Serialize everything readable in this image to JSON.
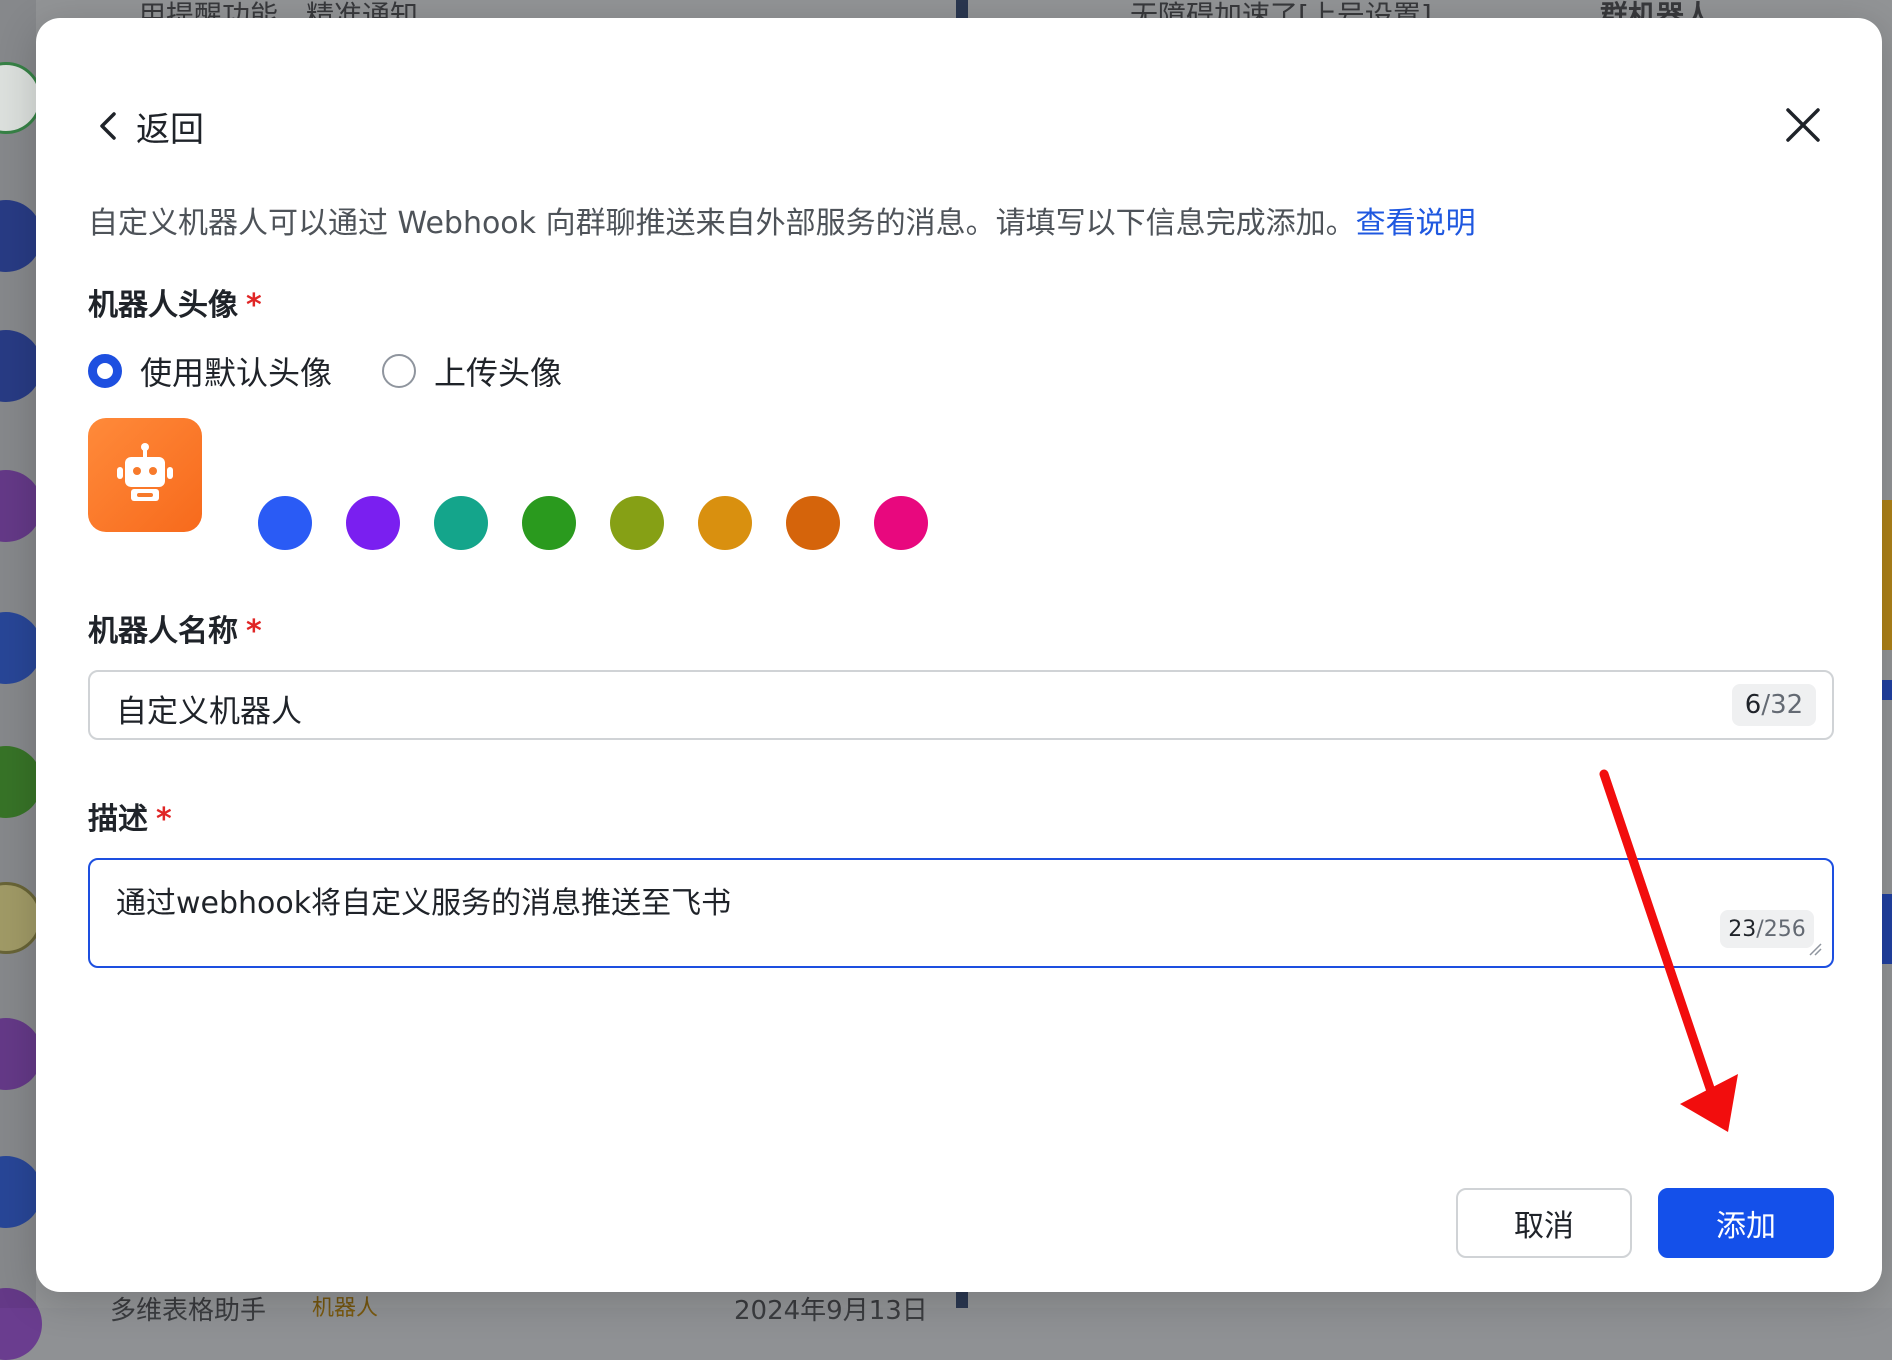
{
  "background": {
    "top_left_text": "…用提醒功能，精准通知…",
    "top_mid_text": "无障碍加速了[上号设置]",
    "top_right_text": "群机器人",
    "bottom_left_text": "多维表格助手",
    "bottom_badge": "机器人",
    "bottom_date": "2024年9月13日"
  },
  "modal": {
    "back_label": "返回",
    "intro_text": "自定义机器人可以通过 Webhook 向群聊推送来自外部服务的消息。请填写以下信息完成添加。",
    "intro_link": "查看说明",
    "avatar_section": {
      "label": "机器人头像",
      "required_mark": "*",
      "options": [
        {
          "label": "使用默认头像",
          "checked": true
        },
        {
          "label": "上传头像",
          "checked": false
        }
      ],
      "preview_color": "#f77a2b",
      "swatches": [
        "#2a5bf5",
        "#7a1ff0",
        "#14a58b",
        "#2a9a1e",
        "#86a015",
        "#d9900f",
        "#d5640b",
        "#e8087e"
      ]
    },
    "name_section": {
      "label": "机器人名称",
      "required_mark": "*",
      "value": "自定义机器人",
      "count_current": "6",
      "count_max": "/32"
    },
    "desc_section": {
      "label": "描述",
      "required_mark": "*",
      "value": "通过webhook将自定义服务的消息推送至飞书",
      "count_current": "23",
      "count_max": "/256"
    },
    "cancel_label": "取消",
    "add_label": "添加"
  },
  "colors": {
    "accent": "#1450ea",
    "link": "#1f58e0",
    "required": "#e02626",
    "annotation_arrow": "#f20d0d"
  }
}
